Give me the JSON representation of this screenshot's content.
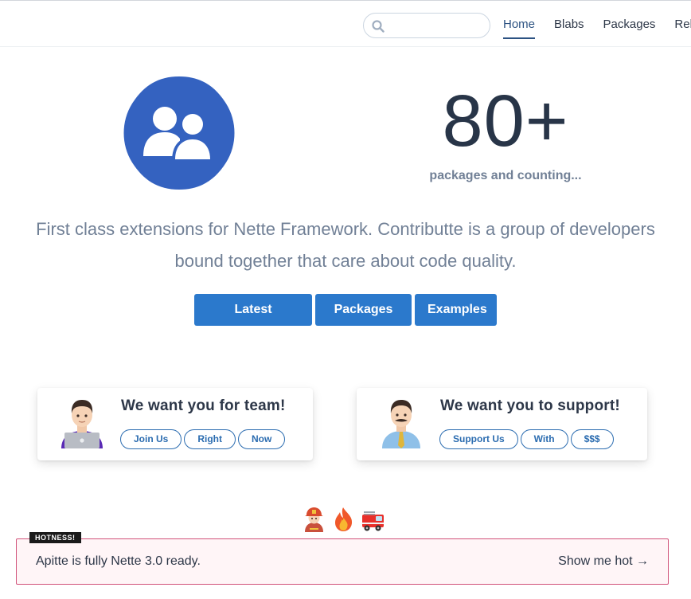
{
  "nav": {
    "search_placeholder": "",
    "items": [
      "Home",
      "Blabs",
      "Packages",
      "Releases"
    ]
  },
  "hero": {
    "count": "80+",
    "count_label": "packages and counting...",
    "tagline": "First class extensions for Nette Framework. Contributte is a group of developers bound together that care about code quality.",
    "buttons": [
      "Latest Releases",
      "Packages →",
      "Examples"
    ]
  },
  "cards": [
    {
      "title": "We want you for team!",
      "pills": [
        "Join Us",
        "Right",
        "Now"
      ],
      "emoji": "technologist-emoji"
    },
    {
      "title": "We want you to support!",
      "pills": [
        "Support Us",
        "With",
        "$$$"
      ],
      "emoji": "office-worker-emoji"
    }
  ],
  "emoji_row": [
    "firefighter-emoji",
    "fire-emoji",
    "fire-engine-emoji"
  ],
  "hotness": {
    "badge": "HOTNESS!",
    "text": "Apitte is fully Nette 3.0 ready.",
    "link": "Show me hot →"
  },
  "colors": {
    "brand_blue": "#2b79cc",
    "logo_blue": "#3462c0",
    "text_dark": "#2d3748",
    "text_muted": "#718096",
    "hot_border": "#d1527a",
    "hot_bg": "#fff5f7"
  }
}
